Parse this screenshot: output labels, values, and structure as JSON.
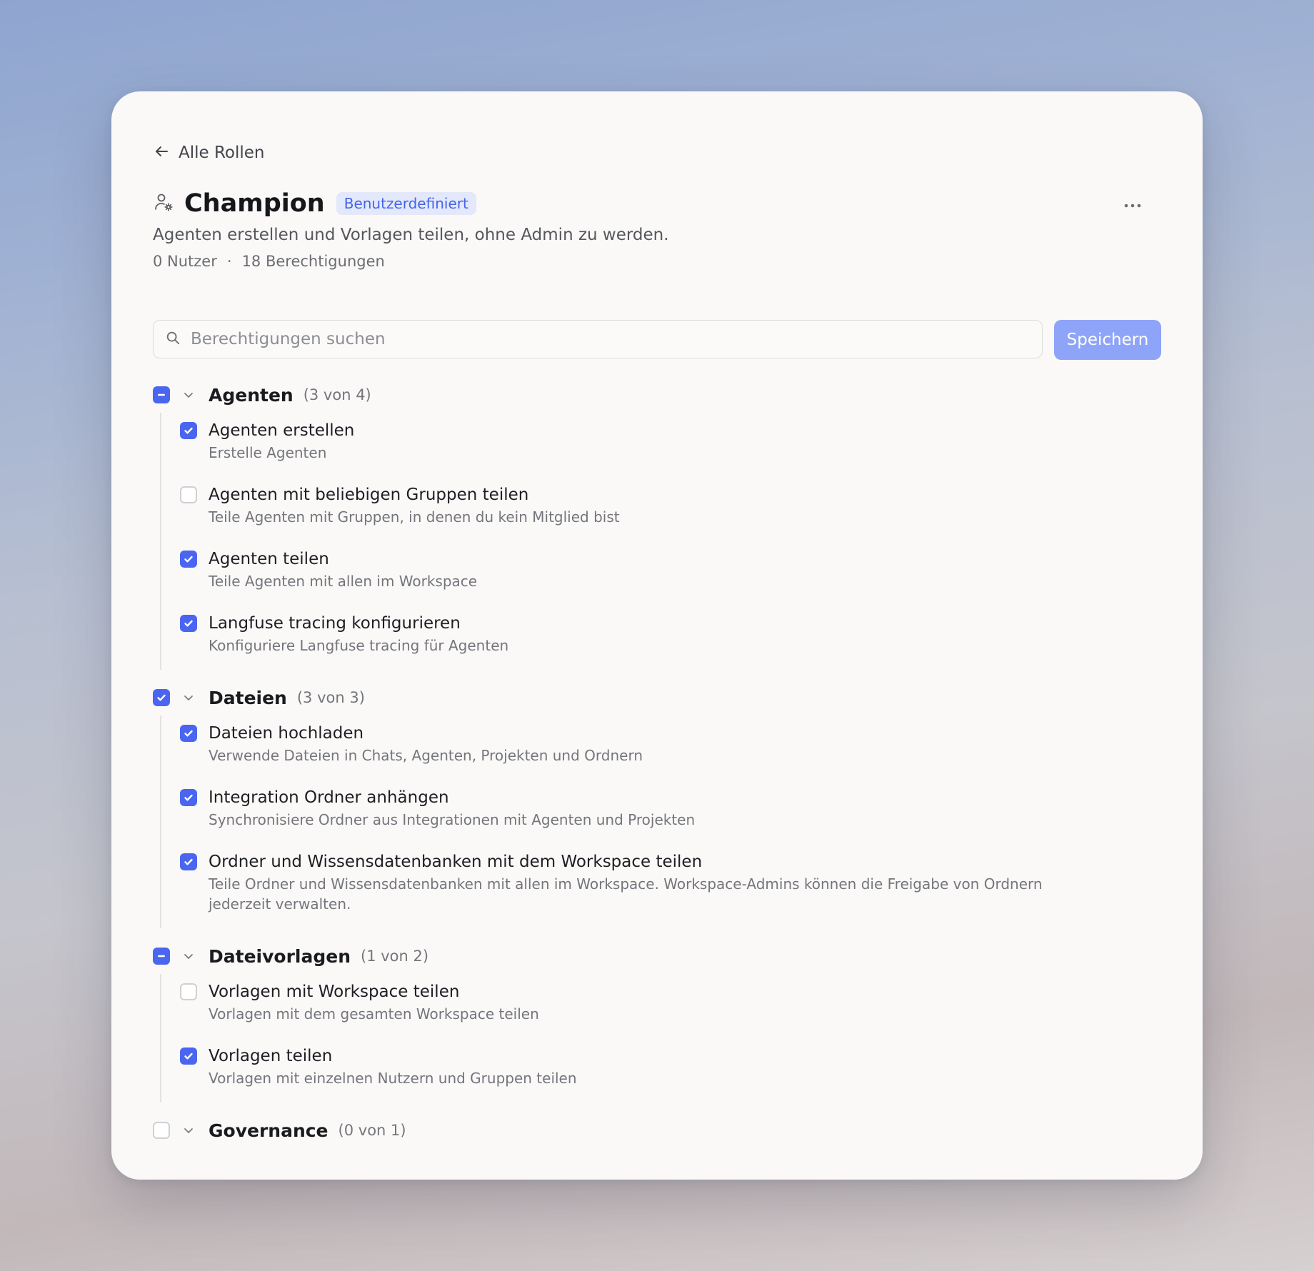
{
  "back": {
    "label": "Alle Rollen"
  },
  "role": {
    "title": "Champion",
    "badge": "Benutzerdefiniert",
    "description": "Agenten erstellen und Vorlagen teilen, ohne Admin zu werden.",
    "users": "0 Nutzer",
    "separator": "·",
    "permissions": "18 Berechtigungen"
  },
  "search": {
    "placeholder": "Berechtigungen suchen"
  },
  "save_label": "Speichern",
  "colors": {
    "accent": "#4a65f0",
    "save_button": "#8ea4f8",
    "badge_bg": "#e3e8fb",
    "badge_text": "#4565e8"
  },
  "groups": [
    {
      "name": "Agenten",
      "count": "(3 von 4)",
      "state": "partial",
      "items": [
        {
          "title": "Agenten erstellen",
          "desc": "Erstelle Agenten",
          "checked": true
        },
        {
          "title": "Agenten mit beliebigen Gruppen teilen",
          "desc": "Teile Agenten mit Gruppen, in denen du kein Mitglied bist",
          "checked": false
        },
        {
          "title": "Agenten teilen",
          "desc": "Teile Agenten mit allen im Workspace",
          "checked": true
        },
        {
          "title": "Langfuse tracing konfigurieren",
          "desc": "Konfiguriere Langfuse tracing für Agenten",
          "checked": true
        }
      ]
    },
    {
      "name": "Dateien",
      "count": "(3 von 3)",
      "state": "checked",
      "items": [
        {
          "title": "Dateien hochladen",
          "desc": "Verwende Dateien in Chats, Agenten, Projekten und Ordnern",
          "checked": true
        },
        {
          "title": "Integration Ordner anhängen",
          "desc": "Synchronisiere Ordner aus Integrationen mit Agenten und Projekten",
          "checked": true
        },
        {
          "title": "Ordner und Wissensdatenbanken mit dem Workspace teilen",
          "desc": "Teile Ordner und Wissensdatenbanken mit allen im Workspace. Workspace-Admins können die Freigabe von Ordnern jederzeit verwalten.",
          "checked": true
        }
      ]
    },
    {
      "name": "Dateivorlagen",
      "count": "(1 von 2)",
      "state": "partial",
      "items": [
        {
          "title": "Vorlagen mit Workspace teilen",
          "desc": "Vorlagen mit dem gesamten Workspace teilen",
          "checked": false
        },
        {
          "title": "Vorlagen teilen",
          "desc": "Vorlagen mit einzelnen Nutzern und Gruppen teilen",
          "checked": true
        }
      ]
    },
    {
      "name": "Governance",
      "count": "(0 von 1)",
      "state": "unchecked",
      "items": []
    }
  ]
}
